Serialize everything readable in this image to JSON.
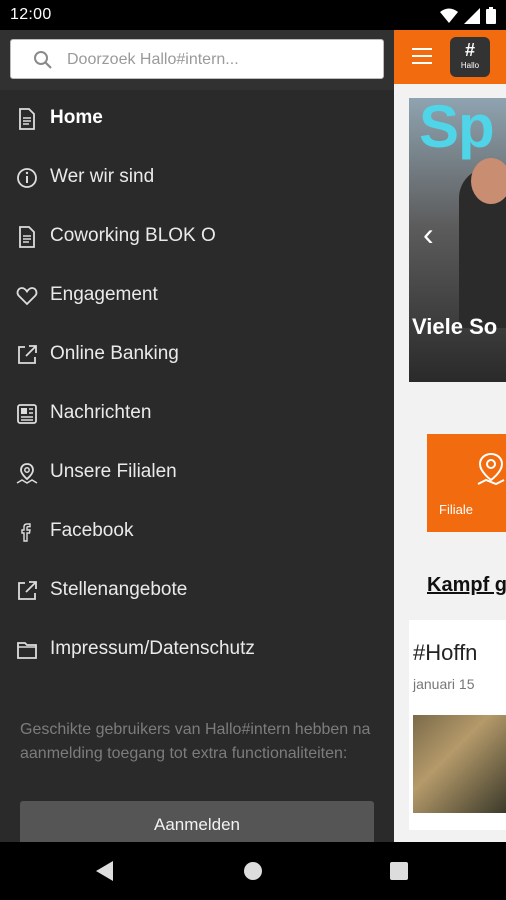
{
  "status_bar": {
    "time": "12:00"
  },
  "app": {
    "logo_symbol": "#",
    "logo_text": "Hallo",
    "carousel_word": "Sp",
    "carousel_caption": "Viele So",
    "tile_label": "Filiale",
    "section_link": "Kampf g",
    "card_title": "#Hoffn",
    "card_date": "januari 15",
    "accent_color": "#f26b0f"
  },
  "drawer": {
    "search_placeholder": "Doorzoek Hallo#intern...",
    "items": [
      {
        "label": "Home",
        "icon": "document-icon"
      },
      {
        "label": "Wer wir sind",
        "icon": "info-icon"
      },
      {
        "label": "Coworking BLOK O",
        "icon": "document-icon"
      },
      {
        "label": "Engagement",
        "icon": "heart-icon"
      },
      {
        "label": "Online Banking",
        "icon": "external-link-icon"
      },
      {
        "label": "Nachrichten",
        "icon": "news-icon"
      },
      {
        "label": "Unsere Filialen",
        "icon": "map-pin-icon"
      },
      {
        "label": "Facebook",
        "icon": "facebook-icon"
      },
      {
        "label": "Stellenangebote",
        "icon": "external-link-icon"
      },
      {
        "label": "Impressum/Datenschutz",
        "icon": "folder-icon"
      }
    ],
    "login_note": "Geschikte gebruikers van Hallo#intern hebben na aanmelding toegang tot extra functionaliteiten:",
    "login_button": "Aanmelden"
  }
}
